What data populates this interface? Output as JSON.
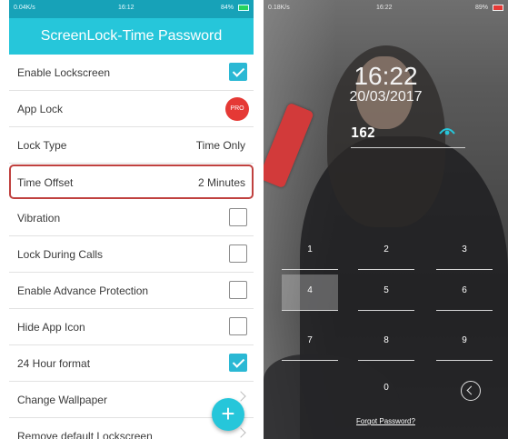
{
  "left_screen": {
    "statusbar": {
      "net": "0.04K/s",
      "time": "16:12",
      "battery": "84%"
    },
    "title": "ScreenLock-Time Password",
    "rows": [
      {
        "label": "Enable Lockscreen",
        "control": "checkbox",
        "checked": true
      },
      {
        "label": "App Lock",
        "control": "badge",
        "badge": "PRO"
      },
      {
        "label": "Lock Type",
        "control": "value",
        "value": "Time Only"
      },
      {
        "label": "Time Offset",
        "control": "value",
        "value": "2 Minutes",
        "highlighted": true
      },
      {
        "label": "Vibration",
        "control": "checkbox",
        "checked": false
      },
      {
        "label": "Lock During Calls",
        "control": "checkbox",
        "checked": false
      },
      {
        "label": "Enable Advance Protection",
        "control": "checkbox",
        "checked": false
      },
      {
        "label": "Hide App Icon",
        "control": "checkbox",
        "checked": false
      },
      {
        "label": "24 Hour format",
        "control": "checkbox",
        "checked": true
      },
      {
        "label": "Change Wallpaper",
        "control": "chevron"
      },
      {
        "label": "Remove default Lockscreen",
        "control": "chevron"
      }
    ],
    "fab_icon": "+",
    "accent_color": "#26c6da",
    "highlight_color": "#c0413f"
  },
  "right_screen": {
    "statusbar": {
      "net": "0.18K/s",
      "time": "16:22",
      "battery": "89%"
    },
    "clock": "16:22",
    "date": "20/03/2017",
    "entered": "162",
    "keys": [
      "1",
      "2",
      "3",
      "4",
      "5",
      "6",
      "7",
      "8",
      "9",
      "0"
    ],
    "pressed_key": "4",
    "forgot_label": "Forgot Password?"
  }
}
